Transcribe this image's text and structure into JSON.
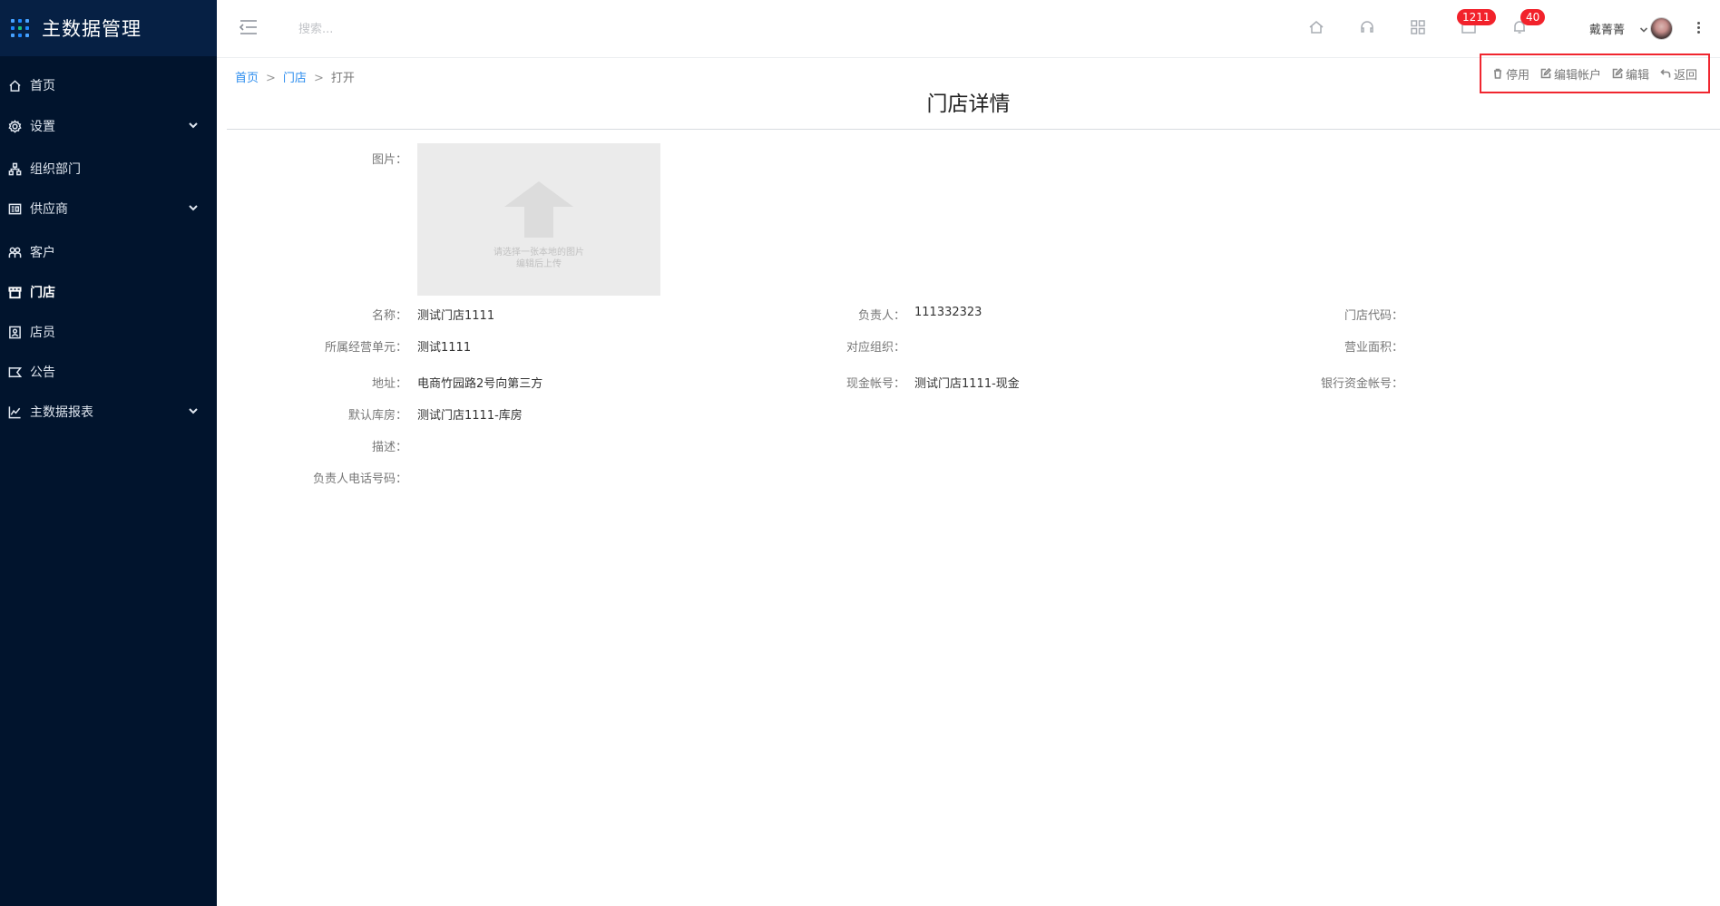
{
  "app": {
    "brand_title": "主数据管理"
  },
  "sidebar": {
    "items": [
      {
        "label": "首页",
        "icon": "home-icon",
        "has_children": false,
        "active": false
      },
      {
        "label": "设置",
        "icon": "gear-icon",
        "has_children": true,
        "active": false
      },
      {
        "label": "组织部门",
        "icon": "org-tree-icon",
        "has_children": false,
        "active": false
      },
      {
        "label": "供应商",
        "icon": "supplier-icon",
        "has_children": true,
        "active": false
      },
      {
        "label": "客户",
        "icon": "customer-icon",
        "has_children": false,
        "active": false
      },
      {
        "label": "门店",
        "icon": "store-icon",
        "has_children": false,
        "active": true
      },
      {
        "label": "店员",
        "icon": "clerk-icon",
        "has_children": false,
        "active": false
      },
      {
        "label": "公告",
        "icon": "announcement-icon",
        "has_children": false,
        "active": false
      },
      {
        "label": "主数据报表",
        "icon": "chart-icon",
        "has_children": true,
        "active": false
      }
    ]
  },
  "header": {
    "search_placeholder": "搜索...",
    "badges": {
      "messages": "1211",
      "notifications": "40"
    },
    "username": "戴菁菁"
  },
  "breadcrumb": {
    "home": "首页",
    "store": "门店",
    "current": "打开",
    "separator": ">"
  },
  "actions": {
    "disable": "停用",
    "edit_account": "编辑帐户",
    "edit": "编辑",
    "back": "返回"
  },
  "page": {
    "title": "门店详情"
  },
  "photo": {
    "label": "图片：",
    "hint_line1": "请选择一张本地的图片",
    "hint_line2": "编辑后上传"
  },
  "fields": {
    "name": {
      "label": "名称：",
      "value": "测试门店1111"
    },
    "manager": {
      "label": "负责人：",
      "value": "111332323"
    },
    "store_code": {
      "label": "门店代码：",
      "value": ""
    },
    "business_unit": {
      "label": "所属经营单元：",
      "value": "测试1111"
    },
    "org": {
      "label": "对应组织：",
      "value": ""
    },
    "area": {
      "label": "营业面积：",
      "value": ""
    },
    "address": {
      "label": "地址：",
      "value": "电商竹园路2号向第三方"
    },
    "cash_account": {
      "label": "现金帐号：",
      "value": "测试门店1111-现金"
    },
    "bank_account": {
      "label": "银行资金帐号：",
      "value": ""
    },
    "default_warehouse": {
      "label": "默认库房：",
      "value": "测试门店1111-库房"
    },
    "description": {
      "label": "描述：",
      "value": ""
    },
    "manager_phone": {
      "label": "负责人电话号码：",
      "value": ""
    }
  }
}
